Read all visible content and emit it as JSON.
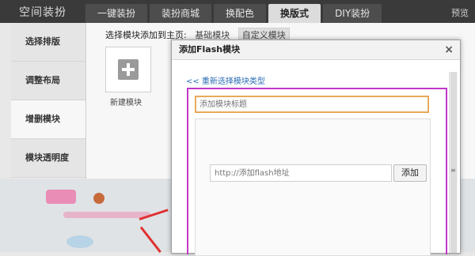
{
  "topbar": {
    "brand": "空间装扮",
    "tabs": [
      "一键装扮",
      "装扮商城",
      "换配色",
      "换版式",
      "DIY装扮"
    ],
    "active_tab_index": 3,
    "preview_label": "预览"
  },
  "sidebar": {
    "items": [
      "选择排版",
      "调整布局",
      "增删模块",
      "模块透明度"
    ],
    "active_index": 2
  },
  "main": {
    "select_label": "选择模块添加到主页:",
    "module_types": [
      "基础模块",
      "自定义模块"
    ],
    "active_module_type_index": 1,
    "new_module_label": "新建模块"
  },
  "dialog": {
    "title": "添加Flash模块",
    "close_label": "×",
    "back_link": "<< 重新选择模块类型",
    "title_input_placeholder": "添加模块标题",
    "url_input_placeholder": "http://添加flash地址",
    "add_button_label": "添加",
    "scroll_grip": "≡"
  },
  "colors": {
    "topbar_bg": "#3a3a3a",
    "highlight_border": "#c236c9",
    "input_focus_border": "#e8a95a",
    "arrow_red": "#e03030",
    "link_blue": "#2a6bb5"
  }
}
